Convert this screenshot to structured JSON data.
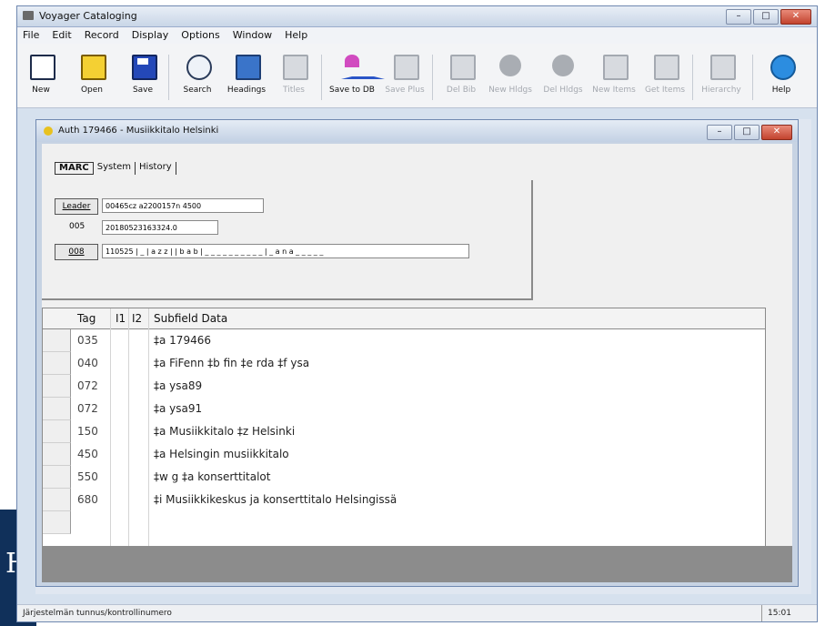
{
  "app": {
    "title": "Voyager Cataloging"
  },
  "menu": [
    "File",
    "Edit",
    "Record",
    "Display",
    "Options",
    "Window",
    "Help"
  ],
  "toolbar": {
    "new": "New",
    "open": "Open",
    "save": "Save",
    "search": "Search",
    "headings": "Headings",
    "titles": "Titles",
    "save_to_db": "Save to DB",
    "save_plus": "Save Plus",
    "del_bib": "Del Bib",
    "new_hldgs": "New Hldgs",
    "del_hldgs": "Del Hldgs",
    "new_items": "New Items",
    "get_items": "Get Items",
    "hierarchy": "Hierarchy",
    "help": "Help"
  },
  "child": {
    "title": "Auth 179466 - Musiikkitalo Helsinki",
    "tabs": [
      "MARC",
      "System",
      "History"
    ],
    "leader_label": "Leader",
    "leader_value": "00465cz  a2200157n  4500",
    "f005_label": "005",
    "f005_value": "20180523163324.0",
    "f008_label": "008",
    "f008_value": "110525 | _ | a z z | | b a b | _ _ _ _ _ _ _ _ _ _ | _ a n a _ _ _ _ _"
  },
  "grid": {
    "headers": {
      "tag": "Tag",
      "i1": "I1",
      "i2": "I2",
      "subfield": "Subfield Data"
    },
    "rows": [
      {
        "tag": "035",
        "data": "‡a 179466"
      },
      {
        "tag": "040",
        "data": "‡a FiFenn ‡b fin ‡e rda ‡f ysa"
      },
      {
        "tag": "072",
        "data": "‡a ysa89"
      },
      {
        "tag": "072",
        "data": "‡a ysa91"
      },
      {
        "tag": "150",
        "data": "‡a Musiikkitalo ‡z Helsinki"
      },
      {
        "tag": "450",
        "data": "‡a Helsingin musiikkitalo"
      },
      {
        "tag": "550",
        "data": "‡w g ‡a konserttitalot"
      },
      {
        "tag": "680",
        "data": "‡i Musiikkikeskus ja konserttitalo Helsingissä"
      }
    ]
  },
  "status": {
    "left": "Järjestelmän tunnus/kontrollinumero",
    "right": "15:01"
  },
  "slide": {
    "letter": "H"
  }
}
